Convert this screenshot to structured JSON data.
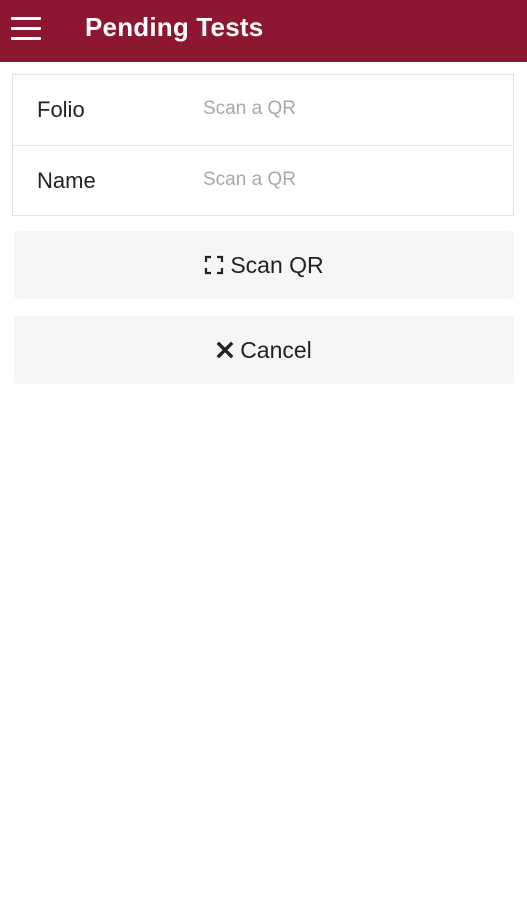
{
  "app_bar": {
    "title": "Pending Tests",
    "menu_icon": "hamburger-menu-icon",
    "color": "#8d1730"
  },
  "form": {
    "fields": [
      {
        "label": "Folio",
        "value": "",
        "placeholder": "Scan a QR"
      },
      {
        "label": "Name",
        "value": "",
        "placeholder": "Scan a QR"
      }
    ]
  },
  "actions": {
    "scan": {
      "label": "Scan QR",
      "icon": "scan-frame-icon"
    },
    "cancel": {
      "label": "Cancel",
      "icon": "close-icon"
    }
  }
}
